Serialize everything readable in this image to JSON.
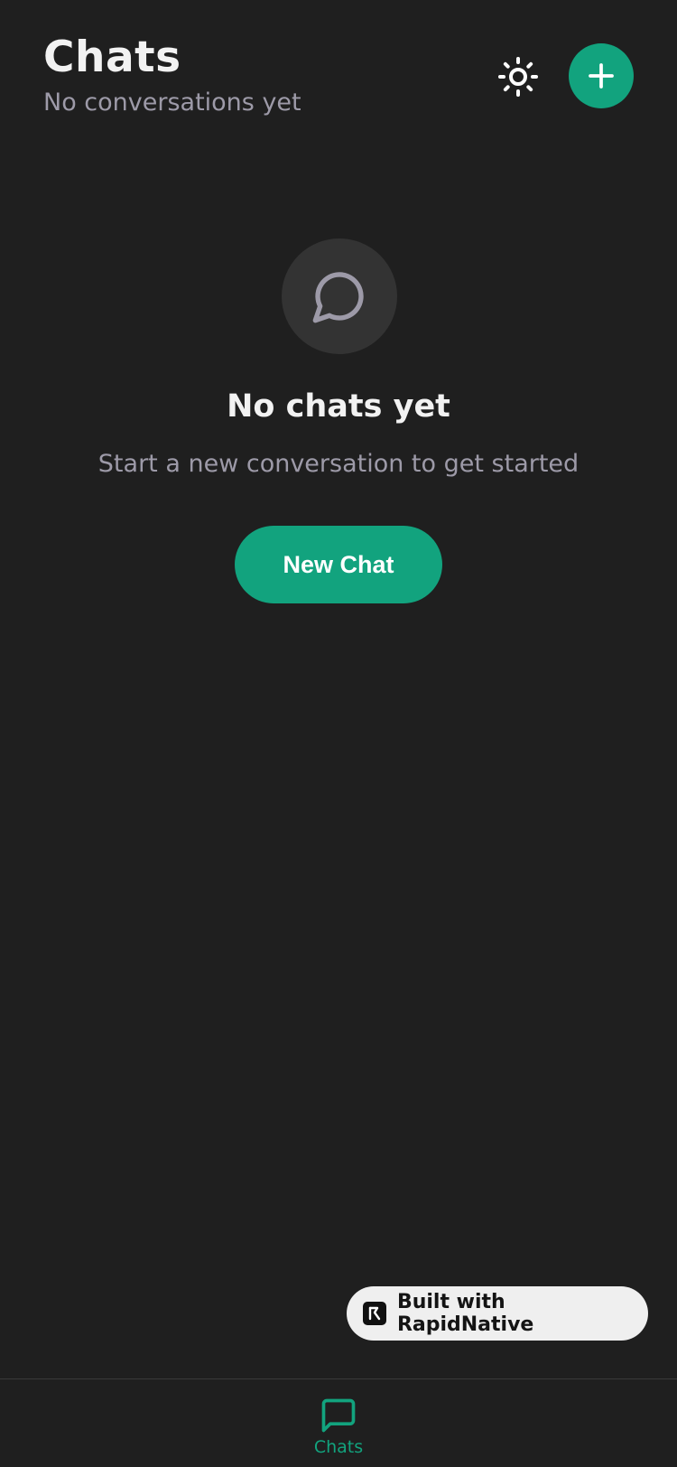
{
  "header": {
    "title": "Chats",
    "subtitle": "No conversations yet"
  },
  "icons": {
    "theme": "sun-icon",
    "add": "plus-icon",
    "empty": "message-circle-icon",
    "nav_chats": "message-square-icon",
    "brand": "rapidnative-logo-icon"
  },
  "empty_state": {
    "title": "No chats yet",
    "subtitle": "Start a new conversation to get started",
    "button_label": "New Chat"
  },
  "badge": {
    "label": "Built with RapidNative"
  },
  "bottom_nav": {
    "items": [
      {
        "label": "Chats",
        "active": true
      }
    ]
  },
  "colors": {
    "background": "#1f1f1f",
    "accent": "#12a37e",
    "muted_text": "#9d9aa8",
    "icon_circle": "#333333",
    "badge_bg": "#efefef"
  }
}
